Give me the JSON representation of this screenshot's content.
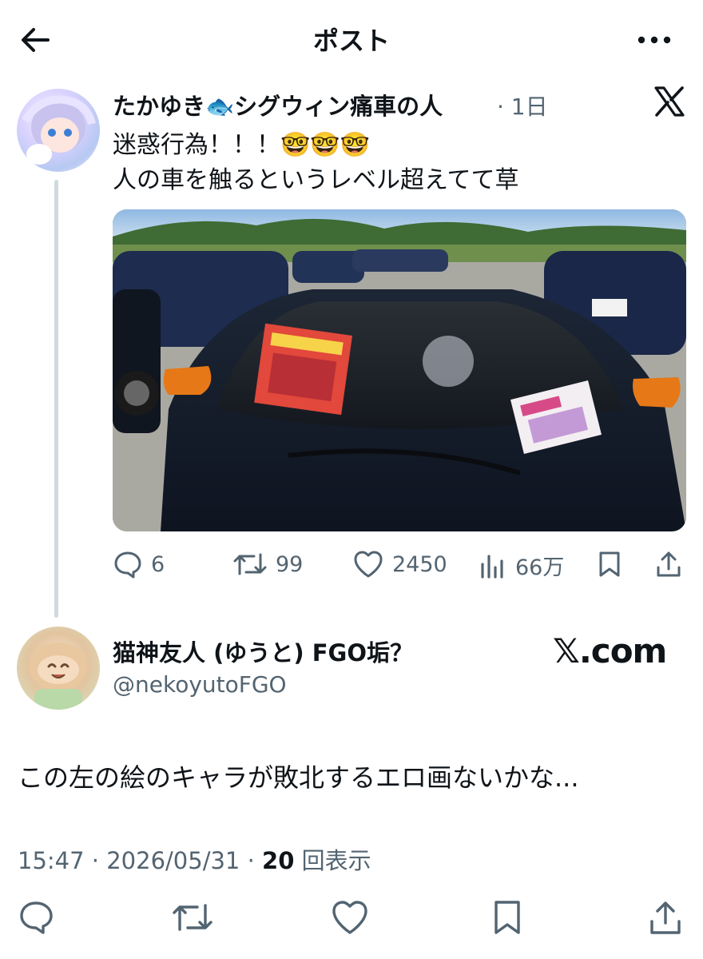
{
  "header": {
    "title": "ポスト"
  },
  "quoted_post": {
    "author_name": "たかゆき🐟シグウィン痛車の人",
    "time": "· 1日",
    "text_line1": "迷惑行為！！！🤓🤓🤓",
    "text_line2": "人の車を触るというレベル超えてて草",
    "stats": {
      "replies": "6",
      "reposts": "99",
      "likes": "2450",
      "views": "66万"
    }
  },
  "reply": {
    "author_name": "猫神友人 (ゆうと) FGO垢？",
    "handle": "@nekoyutoFGO",
    "source_label": "𝕏.com",
    "text": "この左の絵のキャラが敗北するエロ画ないかな...",
    "timestamp": "15:47 · 2026/05/31 · ",
    "view_count": "20",
    "view_label": " 回表示"
  },
  "colors": {
    "text": "#0f1419",
    "muted": "#536471",
    "divider": "#cfd9de"
  },
  "icons": [
    "back-arrow-icon",
    "more-icon",
    "x-logo-icon",
    "reply-icon",
    "repost-icon",
    "like-icon",
    "views-icon",
    "bookmark-icon",
    "share-icon"
  ]
}
